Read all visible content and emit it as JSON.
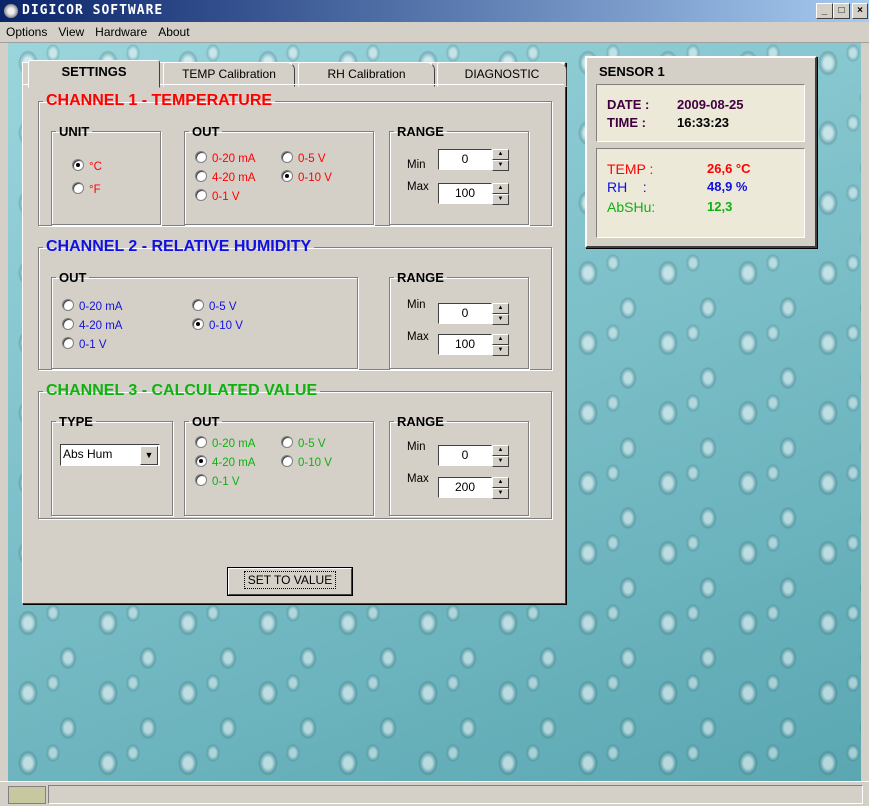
{
  "window": {
    "title": "DIGICOR SOFTWARE",
    "min": "_",
    "max": "□",
    "close": "×"
  },
  "menu": [
    "Options",
    "View",
    "Hardware",
    "About"
  ],
  "tabs": [
    "SETTINGS",
    "TEMP Calibration",
    "RH Calibration",
    "DIAGNOSTIC"
  ],
  "ch1": {
    "title": "CHANNEL 1 - TEMPERATURE",
    "unit_title": "UNIT",
    "units": [
      "°C",
      "°F"
    ],
    "unit_selected": "°C",
    "out_title": "OUT",
    "outs": [
      "0-20 mA",
      "0-5 V",
      "4-20 mA",
      "0-10 V",
      "0-1 V"
    ],
    "out_selected": "0-10 V",
    "range_title": "RANGE",
    "min_label": "Min",
    "max_label": "Max",
    "min": "0",
    "max": "100"
  },
  "ch2": {
    "title": "CHANNEL 2 - RELATIVE HUMIDITY",
    "out_title": "OUT",
    "outs": [
      "0-20 mA",
      "0-5 V",
      "4-20 mA",
      "0-10 V",
      "0-1 V"
    ],
    "out_selected": "0-10 V",
    "range_title": "RANGE",
    "min_label": "Min",
    "max_label": "Max",
    "min": "0",
    "max": "100"
  },
  "ch3": {
    "title": "CHANNEL 3 - CALCULATED VALUE",
    "type_title": "TYPE",
    "type_value": "Abs Hum",
    "out_title": "OUT",
    "outs": [
      "0-20 mA",
      "0-5 V",
      "4-20 mA",
      "0-10 V",
      "0-1 V"
    ],
    "out_selected": "4-20 mA",
    "range_title": "RANGE",
    "min_label": "Min",
    "max_label": "Max",
    "min": "0",
    "max": "200"
  },
  "set_button": "SET TO VALUE",
  "sensor": {
    "title": "SENSOR 1",
    "date_label": "DATE :",
    "date": "2009-08-25",
    "time_label": "TIME :",
    "time": "16:33:23",
    "temp_label": "TEMP :",
    "temp": "26,6 °C",
    "rh_label": "RH    :",
    "rh": "48,9 %",
    "abs_label": "AbSHu:",
    "abs": "12,3"
  },
  "colors": {
    "ch1": "#ff0000",
    "ch2": "#1010e0",
    "ch3": "#10b010",
    "sensor_date": "#400040",
    "title_bar": "#0a246a"
  }
}
